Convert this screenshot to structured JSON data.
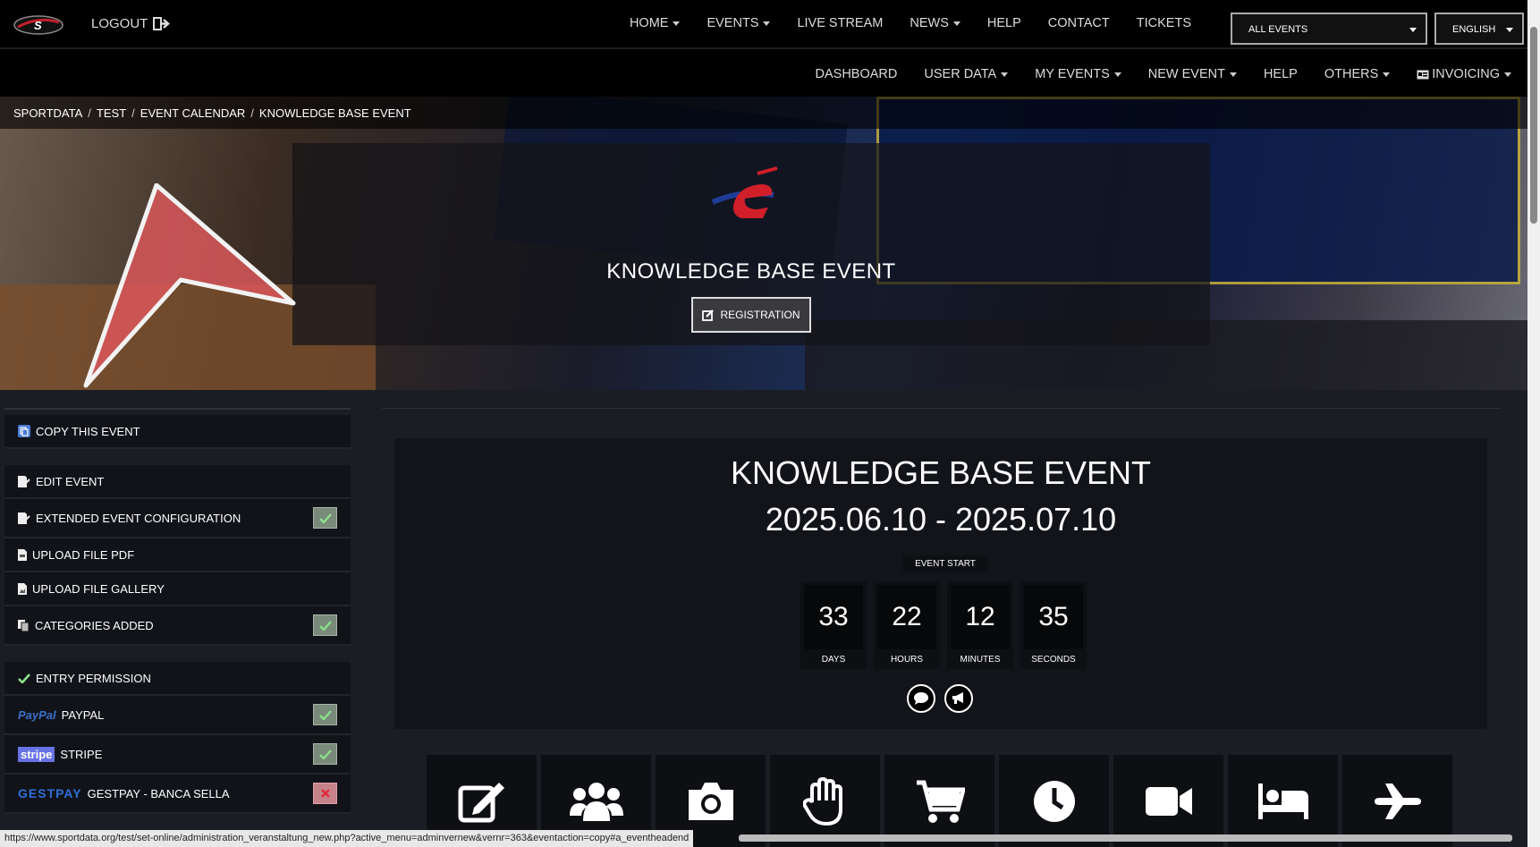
{
  "header": {
    "logout": "LOGOUT",
    "nav": [
      "HOME",
      "EVENTS",
      "LIVE STREAM",
      "NEWS",
      "HELP",
      "CONTACT",
      "TICKETS"
    ],
    "nav_dropdown": [
      true,
      true,
      false,
      true,
      false,
      false,
      false
    ],
    "events_select": "ALL EVENTS",
    "language_select": "ENGLISH"
  },
  "subnav": {
    "items": [
      "DASHBOARD",
      "USER DATA",
      "MY EVENTS",
      "NEW EVENT",
      "HELP",
      "OTHERS",
      "INVOICING"
    ]
  },
  "breadcrumb": [
    "SPORTDATA",
    "TEST",
    "EVENT CALENDAR",
    "KNOWLEDGE BASE EVENT"
  ],
  "hero": {
    "title": "KNOWLEDGE BASE EVENT",
    "registration_button": "REGISTRATION"
  },
  "left_menu": {
    "copy_event": "COPY THIS EVENT",
    "edit_event": "EDIT EVENT",
    "extended_config": "EXTENDED EVENT CONFIGURATION",
    "upload_pdf": "UPLOAD FILE PDF",
    "upload_gallery": "UPLOAD FILE GALLERY",
    "categories_added": "CATEGORIES ADDED",
    "entry_permission": "ENTRY PERMISSION",
    "paypal_logo": "PayPal",
    "paypal": "PAYPAL",
    "stripe_logo": "stripe",
    "stripe": "STRIPE",
    "gestpay_logo": "GESTPAY",
    "gestpay": "GESTPAY - BANCA SELLA"
  },
  "event": {
    "title": "KNOWLEDGE BASE EVENT",
    "dates": "2025.06.10 - 2025.07.10",
    "start_label": "EVENT START",
    "countdown": {
      "days": "33",
      "days_label": "DAYS",
      "hours": "22",
      "hours_label": "HOURS",
      "minutes": "12",
      "minutes_label": "MINUTES",
      "seconds": "35",
      "seconds_label": "SECONDS"
    }
  },
  "colors": {
    "background": "#1b1d25",
    "panel": "#12141a",
    "check_green": "#7a8a7a",
    "check_red": "#c7838a",
    "arrow": "#d9575a"
  },
  "tile_icons": [
    "edit-icon",
    "users-icon",
    "camera-icon",
    "hand-icon",
    "cart-icon",
    "clock-icon",
    "video-icon",
    "bed-icon",
    "plane-icon"
  ],
  "status_url": "https://www.sportdata.org/test/set-online/administration_veranstaltung_new.php?active_menu=adminvernew&vernr=363&eventaction=copy#a_eventheadend"
}
